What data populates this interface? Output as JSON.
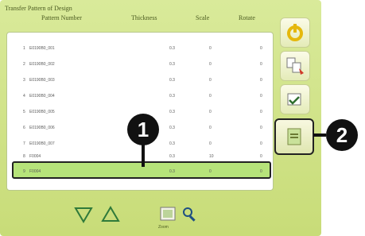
{
  "title": "Transfer Pattern of Design",
  "columns": [
    "Pattern Number",
    "Thickness",
    "Scale",
    "Rotate"
  ],
  "rows": [
    {
      "idx": "1",
      "pn": "E0190B0_001",
      "th": "0.3",
      "st": "0",
      "ro": "0"
    },
    {
      "idx": "2",
      "pn": "E0190B0_002",
      "th": "0.3",
      "st": "0",
      "ro": "0"
    },
    {
      "idx": "3",
      "pn": "E0190B0_003",
      "th": "0.3",
      "st": "0",
      "ro": "0"
    },
    {
      "idx": "4",
      "pn": "E0190B0_004",
      "th": "0.3",
      "st": "0",
      "ro": "0"
    },
    {
      "idx": "5",
      "pn": "E0190B0_005",
      "th": "0.3",
      "st": "0",
      "ro": "0"
    },
    {
      "idx": "6",
      "pn": "E0190B0_006",
      "th": "0.3",
      "st": "0",
      "ro": "0"
    },
    {
      "idx": "7",
      "pn": "E0190B0_007",
      "th": "0.3",
      "st": "0",
      "ro": "0"
    },
    {
      "idx": "8",
      "pn": "F0004",
      "th": "0.3",
      "st": "10",
      "ro": "0"
    },
    {
      "idx": "9",
      "pn": "F0004",
      "th": "0.3",
      "st": "0",
      "ro": "0"
    }
  ],
  "callouts": {
    "one": "1",
    "two": "2"
  },
  "bottom": {
    "zoom_label": "Zoom"
  },
  "colors": {
    "device_bg": "#d9ea9a",
    "selected_row": "#b6e37a",
    "callout": "#111111"
  },
  "icons": {
    "side": [
      "power-icon",
      "sort-icon",
      "edit-icon",
      "info-icon"
    ],
    "bottom": [
      "down-arrow-icon",
      "up-arrow-icon",
      "preview-icon",
      "search-icon"
    ]
  }
}
